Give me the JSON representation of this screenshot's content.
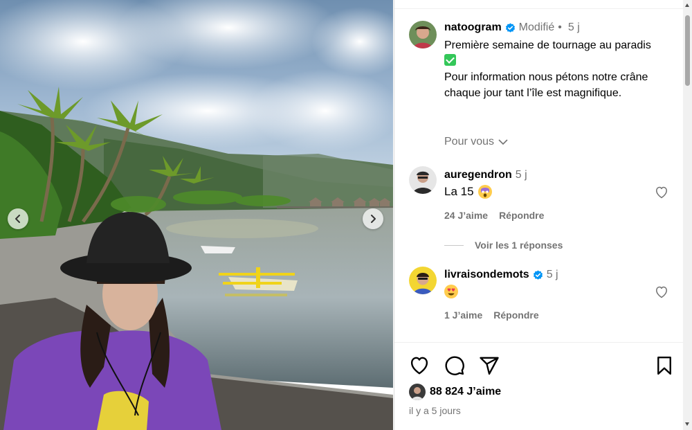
{
  "post": {
    "author": "natoogram",
    "edited_label": "Modifié",
    "separator": "•",
    "age": "5 j",
    "caption_line1": "Première semaine de tournage au paradis",
    "caption_line2": "Pour information nous pétons notre crâne chaque jour tant l’île est magnifique.",
    "for_you": "Pour vous"
  },
  "comments": [
    {
      "username": "auregendron",
      "age": "5 j",
      "text": "La 15",
      "likes": "24 J’aime",
      "reply_label": "Répondre",
      "view_replies": "Voir les 1 réponses"
    },
    {
      "username": "livraisondemots",
      "age": "5 j",
      "verified": true,
      "text": "",
      "likes": "1 J’aime",
      "reply_label": "Répondre"
    }
  ],
  "footer": {
    "likes_count": "88 824 J’aime",
    "time_ago": "il y a 5 jours"
  },
  "colors": {
    "verified_blue": "#0095f6",
    "muted_text": "#737373",
    "check_green": "#34c759"
  },
  "icons": [
    "chevron-left-icon",
    "chevron-right-icon",
    "verified-icon",
    "chevron-down-icon",
    "heart-icon",
    "comment-icon",
    "share-icon",
    "bookmark-icon"
  ]
}
